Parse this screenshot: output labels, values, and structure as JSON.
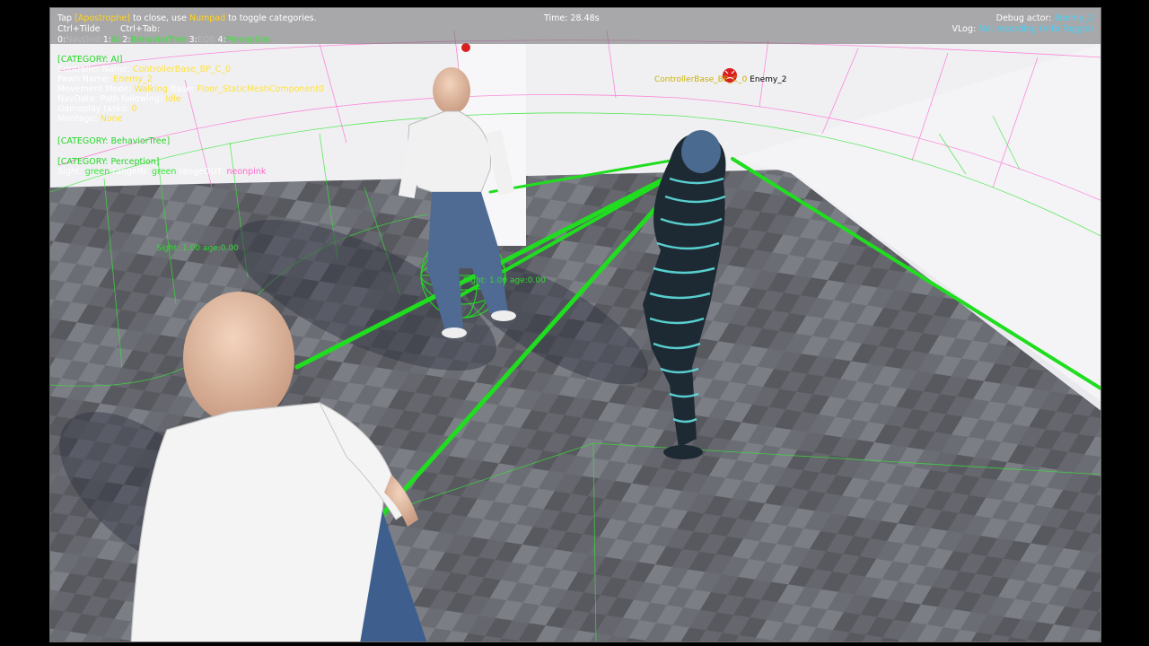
{
  "hud": {
    "line1": {
      "pre": "Tap ",
      "key": "[Apostrophe]",
      "mid": " to close, use ",
      "numpad": "Numpad",
      "post": " to toggle categories."
    },
    "ctrl_tilde": "Ctrl+Tilde",
    "ctrl_tab": "Ctrl+Tab:",
    "categories": [
      {
        "num": "0:",
        "label": "NavGrid"
      },
      {
        "num": "1:",
        "label": "AI"
      },
      {
        "num": "2:",
        "label": "BehaviorTree"
      },
      {
        "num": "3:",
        "label": "EQS"
      },
      {
        "num": "4:",
        "label": "Perception"
      }
    ],
    "time": "Time: 28.48s",
    "debug_actor": {
      "label": "Debug actor:",
      "value": "Enemy_2"
    },
    "vlog": {
      "label": "VLog:",
      "value": "Not recording (V to Toggle)"
    }
  },
  "ai": {
    "header": "[CATEGORY: AI]",
    "rows": [
      {
        "key": "Controller Name:",
        "value": "ControllerBase_BP_C_0"
      },
      {
        "key": "Pawn Name:",
        "value": "Enemy_2"
      },
      {
        "key": "Movement Mode:",
        "value": "Walking",
        "extra_key": "Base:",
        "extra_value": "Floor_StaticMeshComponent0"
      },
      {
        "key": "NavData:",
        "value": "",
        "extra_key": "Path following:",
        "extra_value": "Idle"
      },
      {
        "key": "Gameplay tasks:",
        "value": "0"
      },
      {
        "key": "Montage:",
        "value": "None"
      }
    ]
  },
  "behavior_tree": {
    "header": "[CATEGORY: BehaviorTree]"
  },
  "perception": {
    "header": "[CATEGORY: Perception]",
    "legend": [
      {
        "label": "Sight:",
        "value": "green"
      },
      {
        "label": "rangeIN:",
        "value": "green"
      },
      {
        "label": "rangeOUT:",
        "value": "neonpink"
      }
    ]
  },
  "world_labels": {
    "controller": "ControllerBase_BP_C_0",
    "enemy": "Enemy_2",
    "sight1": "Sight: 1.00 age:0.00",
    "sight2": "Sight: 1.00 age:0.00"
  },
  "colors": {
    "sight_line": "#20dd20",
    "range_in": "#36e636",
    "range_out": "#ff66cc",
    "highlight_yellow": "#ffd21f",
    "floor_dark": "#5d5f66",
    "floor_light": "#8a8c93",
    "wall": "#eeeef2"
  }
}
